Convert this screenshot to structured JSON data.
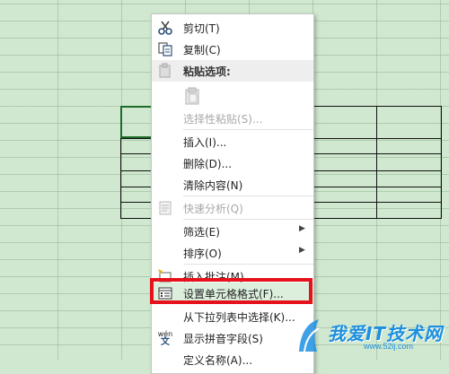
{
  "menu": {
    "cut": "剪切(T)",
    "copy": "复制(C)",
    "paste_options_header": "粘贴选项:",
    "paste_special": "选择性粘贴(S)...",
    "insert": "插入(I)...",
    "delete": "删除(D)...",
    "clear_contents": "清除内容(N)",
    "quick_analysis": "快速分析(Q)",
    "filter": "筛选(E)",
    "sort": "排序(O)",
    "insert_comment": "插入批注(M)",
    "format_cells": "设置单元格格式(F)...",
    "pick_from_dropdown": "从下拉列表中选择(K)...",
    "show_phonetic": "显示拼音字段(S)",
    "define_name": "定义名称(A)..."
  },
  "icons": {
    "cut": "scissors-icon",
    "copy": "copy-icon",
    "paste": "clipboard-icon",
    "quick_analysis": "quick-analysis-icon",
    "comment": "comment-icon",
    "format_cells": "format-cells-icon",
    "phonetic": "phonetic-guide-icon",
    "phonetic_label": "wén"
  },
  "watermark": {
    "text": "我爱IT技术网",
    "url": "www.52ij.com"
  },
  "colors": {
    "sheet_bg": "#cfe8cf",
    "highlight_box": "#e6111b",
    "watermark": "#1d8fe0"
  }
}
